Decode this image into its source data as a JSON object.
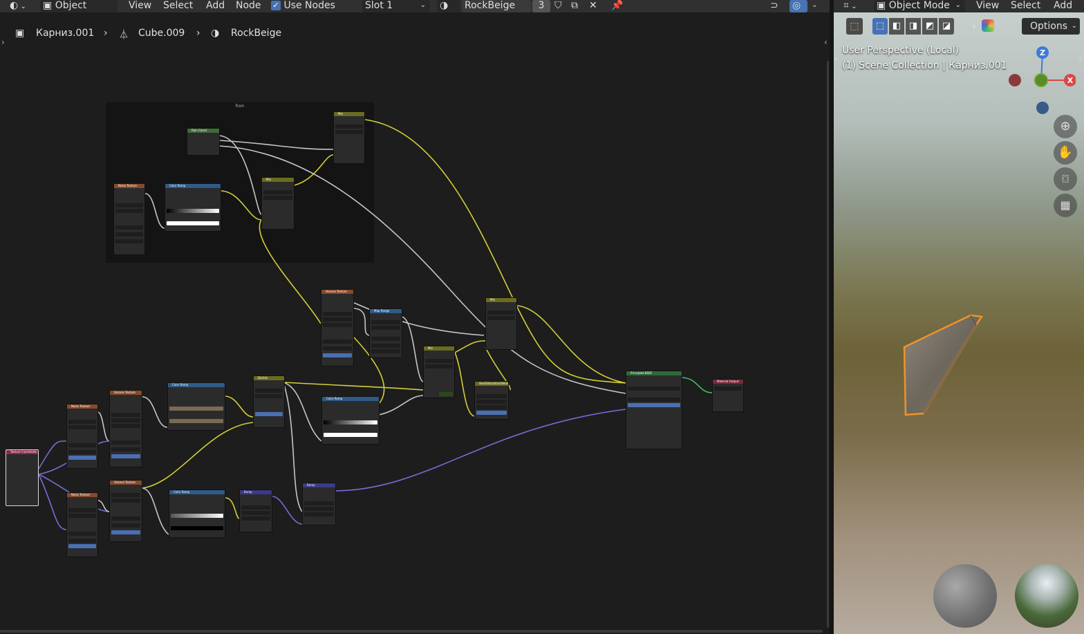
{
  "node_editor_header": {
    "mode": "Object",
    "menus": [
      "View",
      "Select",
      "Add",
      "Node"
    ],
    "use_nodes_label": "Use Nodes",
    "slot": "Slot 1",
    "material_name": "RockBeige",
    "user_count": "3"
  },
  "breadcrumb": {
    "object": "Карниз.001",
    "mesh": "Cube.009",
    "material": "RockBeige"
  },
  "frame_label": "Rain",
  "nodes": [
    {
      "id": "n_rain_tc",
      "title": "Rain Coord",
      "color": "#3e6b3a"
    },
    {
      "id": "n_mix_top",
      "title": "Mix",
      "color": "#6b6b1f"
    },
    {
      "id": "n_noise_r",
      "title": "Noise Texture",
      "color": "#8a4a2a"
    },
    {
      "id": "n_cramp_r",
      "title": "Color Ramp",
      "color": "#2e5b8a"
    },
    {
      "id": "n_mix_r",
      "title": "Mix",
      "color": "#6b6b1f"
    },
    {
      "id": "n_voronoi_m",
      "title": "Voronoi Texture",
      "color": "#8a4a2a"
    },
    {
      "id": "n_maprange",
      "title": "Map Range",
      "color": "#2e5b8a"
    },
    {
      "id": "n_mix_c",
      "title": "Mix",
      "color": "#6b6b1f"
    },
    {
      "id": "n_mix_r2",
      "title": "Mix",
      "color": "#6b6b1f"
    },
    {
      "id": "n_hsv",
      "title": "Hue/Saturation/Value",
      "color": "#6b6b1f"
    },
    {
      "id": "n_bsdf",
      "title": "Principled BSDF",
      "color": "#2e6b3a"
    },
    {
      "id": "n_out",
      "title": "Material Output",
      "color": "#7a2a3a"
    },
    {
      "id": "n_texcoord",
      "title": "Texture Coordinate",
      "color": "#8a2a4a"
    },
    {
      "id": "n_noise1",
      "title": "Noise Texture",
      "color": "#8a4a2a"
    },
    {
      "id": "n_noise2",
      "title": "Noise Texture",
      "color": "#8a4a2a"
    },
    {
      "id": "n_voronoi1",
      "title": "Voronoi Texture",
      "color": "#8a4a2a"
    },
    {
      "id": "n_voronoi2",
      "title": "Voronoi Texture",
      "color": "#8a4a2a"
    },
    {
      "id": "n_cramp1",
      "title": "Color Ramp",
      "color": "#2e5b8a"
    },
    {
      "id": "n_cramp2",
      "title": "Color Ramp",
      "color": "#2e5b8a"
    },
    {
      "id": "n_darken",
      "title": "Darken",
      "color": "#6b6b1f"
    },
    {
      "id": "n_cramp3",
      "title": "Color Ramp",
      "color": "#2e5b8a"
    },
    {
      "id": "n_bump1",
      "title": "Bump",
      "color": "#3a3a8a"
    },
    {
      "id": "n_bump2",
      "title": "Bump",
      "color": "#3a3a8a"
    }
  ],
  "viewport_header": {
    "mode": "Object Mode",
    "menus": [
      "View",
      "Select",
      "Add"
    ],
    "options_label": "Options"
  },
  "viewport": {
    "perspective": "User Perspective (Local)",
    "collection": "(1) Scene Collection | Карниз.001",
    "axes": {
      "z": "Z",
      "x": "X"
    }
  }
}
